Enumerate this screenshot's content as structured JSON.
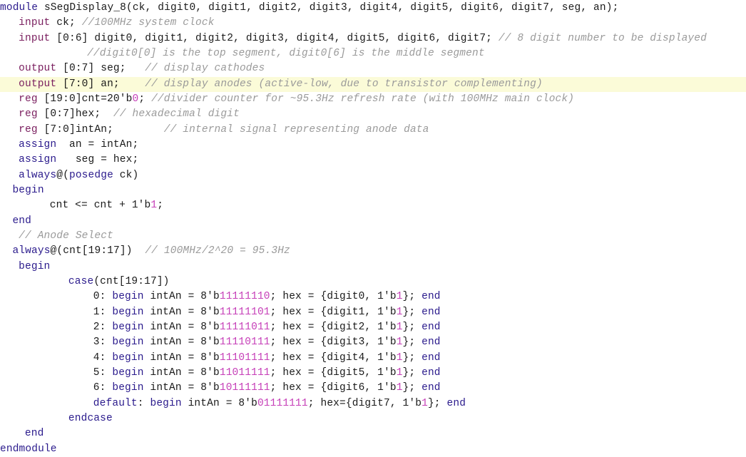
{
  "editor": {
    "language": "Verilog",
    "module_name": "sSegDisplay_8",
    "highlighted_line_number": 6,
    "colors": {
      "background": "#ffffff",
      "foreground": "#1a1a1a",
      "keyword": "#2a1a8c",
      "type": "#7b2060",
      "comment": "#9a9a9a",
      "number": "#c63fb8",
      "line_highlight": "#fbfbd8"
    }
  },
  "code": {
    "lines": [
      {
        "indent": 0,
        "highlight": false,
        "tokens": [
          {
            "t": "keyword",
            "v": "module"
          },
          {
            "t": "plain",
            "v": " sSegDisplay_8(ck, digit0, digit1, digit2, digit3, digit4, digit5, digit6, digit7, seg, an);"
          }
        ]
      },
      {
        "indent": 3,
        "highlight": false,
        "tokens": [
          {
            "t": "type",
            "v": "input"
          },
          {
            "t": "plain",
            "v": " ck; "
          },
          {
            "t": "comment",
            "v": "//100MHz system clock"
          }
        ]
      },
      {
        "indent": 3,
        "highlight": false,
        "tokens": [
          {
            "t": "type",
            "v": "input"
          },
          {
            "t": "plain",
            "v": " [0:6] digit0, digit1, digit2, digit3, digit4, digit5, digit6, digit7; "
          },
          {
            "t": "comment",
            "v": "// 8 digit number to be displayed"
          }
        ]
      },
      {
        "indent": 14,
        "highlight": false,
        "tokens": [
          {
            "t": "comment",
            "v": "//digit0[0] is the top segment, digit0[6] is the middle segment"
          }
        ]
      },
      {
        "indent": 3,
        "highlight": false,
        "tokens": [
          {
            "t": "type",
            "v": "output"
          },
          {
            "t": "plain",
            "v": " [0:7] seg;   "
          },
          {
            "t": "comment",
            "v": "// display cathodes"
          }
        ]
      },
      {
        "indent": 3,
        "highlight": true,
        "tokens": [
          {
            "t": "type",
            "v": "output"
          },
          {
            "t": "plain",
            "v": " [7:0] an;    "
          },
          {
            "t": "comment",
            "v": "// display anodes (active-low, due to transistor complementing)"
          }
        ]
      },
      {
        "indent": 3,
        "highlight": false,
        "tokens": [
          {
            "t": "type",
            "v": "reg"
          },
          {
            "t": "plain",
            "v": " [19:0]cnt=20'b"
          },
          {
            "t": "number",
            "v": "0"
          },
          {
            "t": "plain",
            "v": "; "
          },
          {
            "t": "comment",
            "v": "//divider counter for ~95.3Hz refresh rate (with 100MHz main clock)"
          }
        ]
      },
      {
        "indent": 3,
        "highlight": false,
        "tokens": [
          {
            "t": "type",
            "v": "reg"
          },
          {
            "t": "plain",
            "v": " [0:7]hex;  "
          },
          {
            "t": "comment",
            "v": "// hexadecimal digit"
          }
        ]
      },
      {
        "indent": 3,
        "highlight": false,
        "tokens": [
          {
            "t": "type",
            "v": "reg"
          },
          {
            "t": "plain",
            "v": " [7:0]intAn;        "
          },
          {
            "t": "comment",
            "v": "// internal signal representing anode data"
          }
        ]
      },
      {
        "indent": 3,
        "highlight": false,
        "tokens": [
          {
            "t": "keyword",
            "v": "assign"
          },
          {
            "t": "plain",
            "v": "  an = intAn;"
          }
        ]
      },
      {
        "indent": 3,
        "highlight": false,
        "tokens": [
          {
            "t": "keyword",
            "v": "assign"
          },
          {
            "t": "plain",
            "v": "   seg = hex;"
          }
        ]
      },
      {
        "indent": 3,
        "highlight": false,
        "tokens": [
          {
            "t": "keyword",
            "v": "always"
          },
          {
            "t": "plain",
            "v": "@("
          },
          {
            "t": "keyword",
            "v": "posedge"
          },
          {
            "t": "plain",
            "v": " ck)"
          }
        ]
      },
      {
        "indent": 2,
        "highlight": false,
        "tokens": [
          {
            "t": "keyword",
            "v": "begin"
          }
        ]
      },
      {
        "indent": 8,
        "highlight": false,
        "tokens": [
          {
            "t": "plain",
            "v": "cnt <= cnt + 1'b"
          },
          {
            "t": "number",
            "v": "1"
          },
          {
            "t": "plain",
            "v": ";"
          }
        ]
      },
      {
        "indent": 2,
        "highlight": false,
        "tokens": [
          {
            "t": "keyword",
            "v": "end"
          }
        ]
      },
      {
        "indent": 3,
        "highlight": false,
        "tokens": [
          {
            "t": "comment",
            "v": "// Anode Select"
          }
        ]
      },
      {
        "indent": 2,
        "highlight": false,
        "tokens": [
          {
            "t": "keyword",
            "v": "always"
          },
          {
            "t": "plain",
            "v": "@(cnt[19:17])  "
          },
          {
            "t": "comment",
            "v": "// 100MHz/2^20 = 95.3Hz"
          }
        ]
      },
      {
        "indent": 3,
        "highlight": false,
        "tokens": [
          {
            "t": "keyword",
            "v": "begin"
          }
        ]
      },
      {
        "indent": 11,
        "highlight": false,
        "tokens": [
          {
            "t": "keyword",
            "v": "case"
          },
          {
            "t": "plain",
            "v": "(cnt[19:17])"
          }
        ]
      },
      {
        "indent": 15,
        "highlight": false,
        "tokens": [
          {
            "t": "plain",
            "v": "0: "
          },
          {
            "t": "keyword",
            "v": "begin"
          },
          {
            "t": "plain",
            "v": " intAn = 8'b"
          },
          {
            "t": "number",
            "v": "11111110"
          },
          {
            "t": "plain",
            "v": "; hex = {digit0, 1'b"
          },
          {
            "t": "number",
            "v": "1"
          },
          {
            "t": "plain",
            "v": "}; "
          },
          {
            "t": "keyword",
            "v": "end"
          }
        ]
      },
      {
        "indent": 15,
        "highlight": false,
        "tokens": [
          {
            "t": "plain",
            "v": "1: "
          },
          {
            "t": "keyword",
            "v": "begin"
          },
          {
            "t": "plain",
            "v": " intAn = 8'b"
          },
          {
            "t": "number",
            "v": "11111101"
          },
          {
            "t": "plain",
            "v": "; hex = {digit1, 1'b"
          },
          {
            "t": "number",
            "v": "1"
          },
          {
            "t": "plain",
            "v": "}; "
          },
          {
            "t": "keyword",
            "v": "end"
          }
        ]
      },
      {
        "indent": 15,
        "highlight": false,
        "tokens": [
          {
            "t": "plain",
            "v": "2: "
          },
          {
            "t": "keyword",
            "v": "begin"
          },
          {
            "t": "plain",
            "v": " intAn = 8'b"
          },
          {
            "t": "number",
            "v": "11111011"
          },
          {
            "t": "plain",
            "v": "; hex = {digit2, 1'b"
          },
          {
            "t": "number",
            "v": "1"
          },
          {
            "t": "plain",
            "v": "}; "
          },
          {
            "t": "keyword",
            "v": "end"
          }
        ]
      },
      {
        "indent": 15,
        "highlight": false,
        "tokens": [
          {
            "t": "plain",
            "v": "3: "
          },
          {
            "t": "keyword",
            "v": "begin"
          },
          {
            "t": "plain",
            "v": " intAn = 8'b"
          },
          {
            "t": "number",
            "v": "11110111"
          },
          {
            "t": "plain",
            "v": "; hex = {digit3, 1'b"
          },
          {
            "t": "number",
            "v": "1"
          },
          {
            "t": "plain",
            "v": "}; "
          },
          {
            "t": "keyword",
            "v": "end"
          }
        ]
      },
      {
        "indent": 15,
        "highlight": false,
        "tokens": [
          {
            "t": "plain",
            "v": "4: "
          },
          {
            "t": "keyword",
            "v": "begin"
          },
          {
            "t": "plain",
            "v": " intAn = 8'b"
          },
          {
            "t": "number",
            "v": "11101111"
          },
          {
            "t": "plain",
            "v": "; hex = {digit4, 1'b"
          },
          {
            "t": "number",
            "v": "1"
          },
          {
            "t": "plain",
            "v": "}; "
          },
          {
            "t": "keyword",
            "v": "end"
          }
        ]
      },
      {
        "indent": 15,
        "highlight": false,
        "tokens": [
          {
            "t": "plain",
            "v": "5: "
          },
          {
            "t": "keyword",
            "v": "begin"
          },
          {
            "t": "plain",
            "v": " intAn = 8'b"
          },
          {
            "t": "number",
            "v": "11011111"
          },
          {
            "t": "plain",
            "v": "; hex = {digit5, 1'b"
          },
          {
            "t": "number",
            "v": "1"
          },
          {
            "t": "plain",
            "v": "}; "
          },
          {
            "t": "keyword",
            "v": "end"
          }
        ]
      },
      {
        "indent": 15,
        "highlight": false,
        "tokens": [
          {
            "t": "plain",
            "v": "6: "
          },
          {
            "t": "keyword",
            "v": "begin"
          },
          {
            "t": "plain",
            "v": " intAn = 8'b"
          },
          {
            "t": "number",
            "v": "10111111"
          },
          {
            "t": "plain",
            "v": "; hex = {digit6, 1'b"
          },
          {
            "t": "number",
            "v": "1"
          },
          {
            "t": "plain",
            "v": "}; "
          },
          {
            "t": "keyword",
            "v": "end"
          }
        ]
      },
      {
        "indent": 15,
        "highlight": false,
        "tokens": [
          {
            "t": "keyword",
            "v": "default"
          },
          {
            "t": "plain",
            "v": ": "
          },
          {
            "t": "keyword",
            "v": "begin"
          },
          {
            "t": "plain",
            "v": " intAn = 8'b"
          },
          {
            "t": "number",
            "v": "01111111"
          },
          {
            "t": "plain",
            "v": "; hex={digit7, 1'b"
          },
          {
            "t": "number",
            "v": "1"
          },
          {
            "t": "plain",
            "v": "}; "
          },
          {
            "t": "keyword",
            "v": "end"
          }
        ]
      },
      {
        "indent": 11,
        "highlight": false,
        "tokens": [
          {
            "t": "keyword",
            "v": "endcase"
          }
        ]
      },
      {
        "indent": 4,
        "highlight": false,
        "tokens": [
          {
            "t": "keyword",
            "v": "end"
          }
        ]
      },
      {
        "indent": 0,
        "highlight": false,
        "tokens": [
          {
            "t": "keyword",
            "v": "endmodule"
          }
        ]
      }
    ]
  }
}
